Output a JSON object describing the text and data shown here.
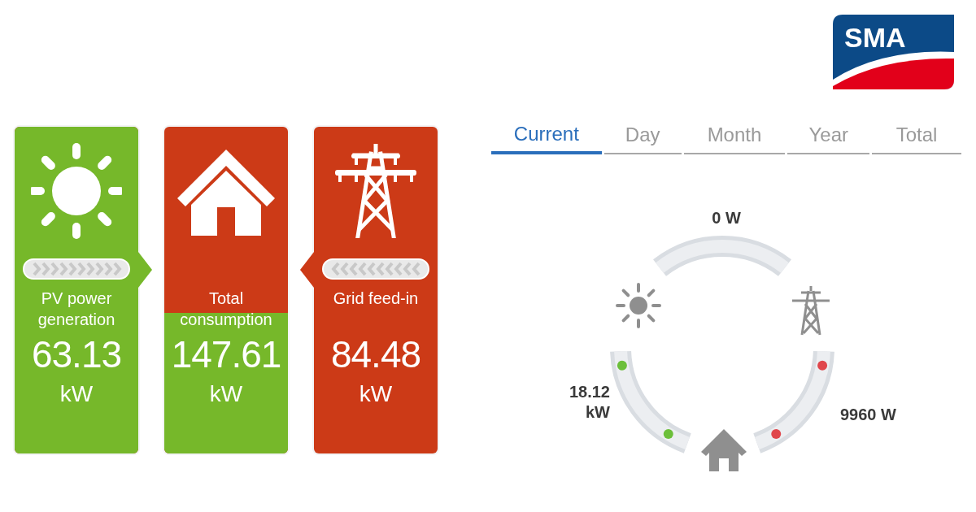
{
  "logo": {
    "text": "SMA"
  },
  "cards": [
    {
      "kind": "sun",
      "pointer_right": true,
      "pointer_left": false,
      "label": "PV power generation",
      "value": "63.13",
      "unit": "kW",
      "level": 1
    },
    {
      "kind": "house",
      "pointer_right": false,
      "pointer_left": false,
      "label": "Total consumption",
      "value": "147.61",
      "unit": "kW",
      "level": 0.43
    },
    {
      "kind": "pylon",
      "pointer_right": false,
      "pointer_left": true,
      "label": "Grid feed-in",
      "value": "84.48",
      "unit": "kW",
      "level": 0
    }
  ],
  "tabs": [
    {
      "label": "Current",
      "selected": true
    },
    {
      "label": "Day",
      "selected": false
    },
    {
      "label": "Month",
      "selected": false
    },
    {
      "label": "Year",
      "selected": false
    },
    {
      "label": "Total",
      "selected": false
    }
  ],
  "flows": [
    {
      "kind": "top",
      "reading": "0 W"
    },
    {
      "kind": "left",
      "reading": "18.12 kW",
      "color": "#6cbf3a"
    },
    {
      "kind": "right",
      "reading": "9960 W",
      "color": "#e0474c"
    }
  ]
}
